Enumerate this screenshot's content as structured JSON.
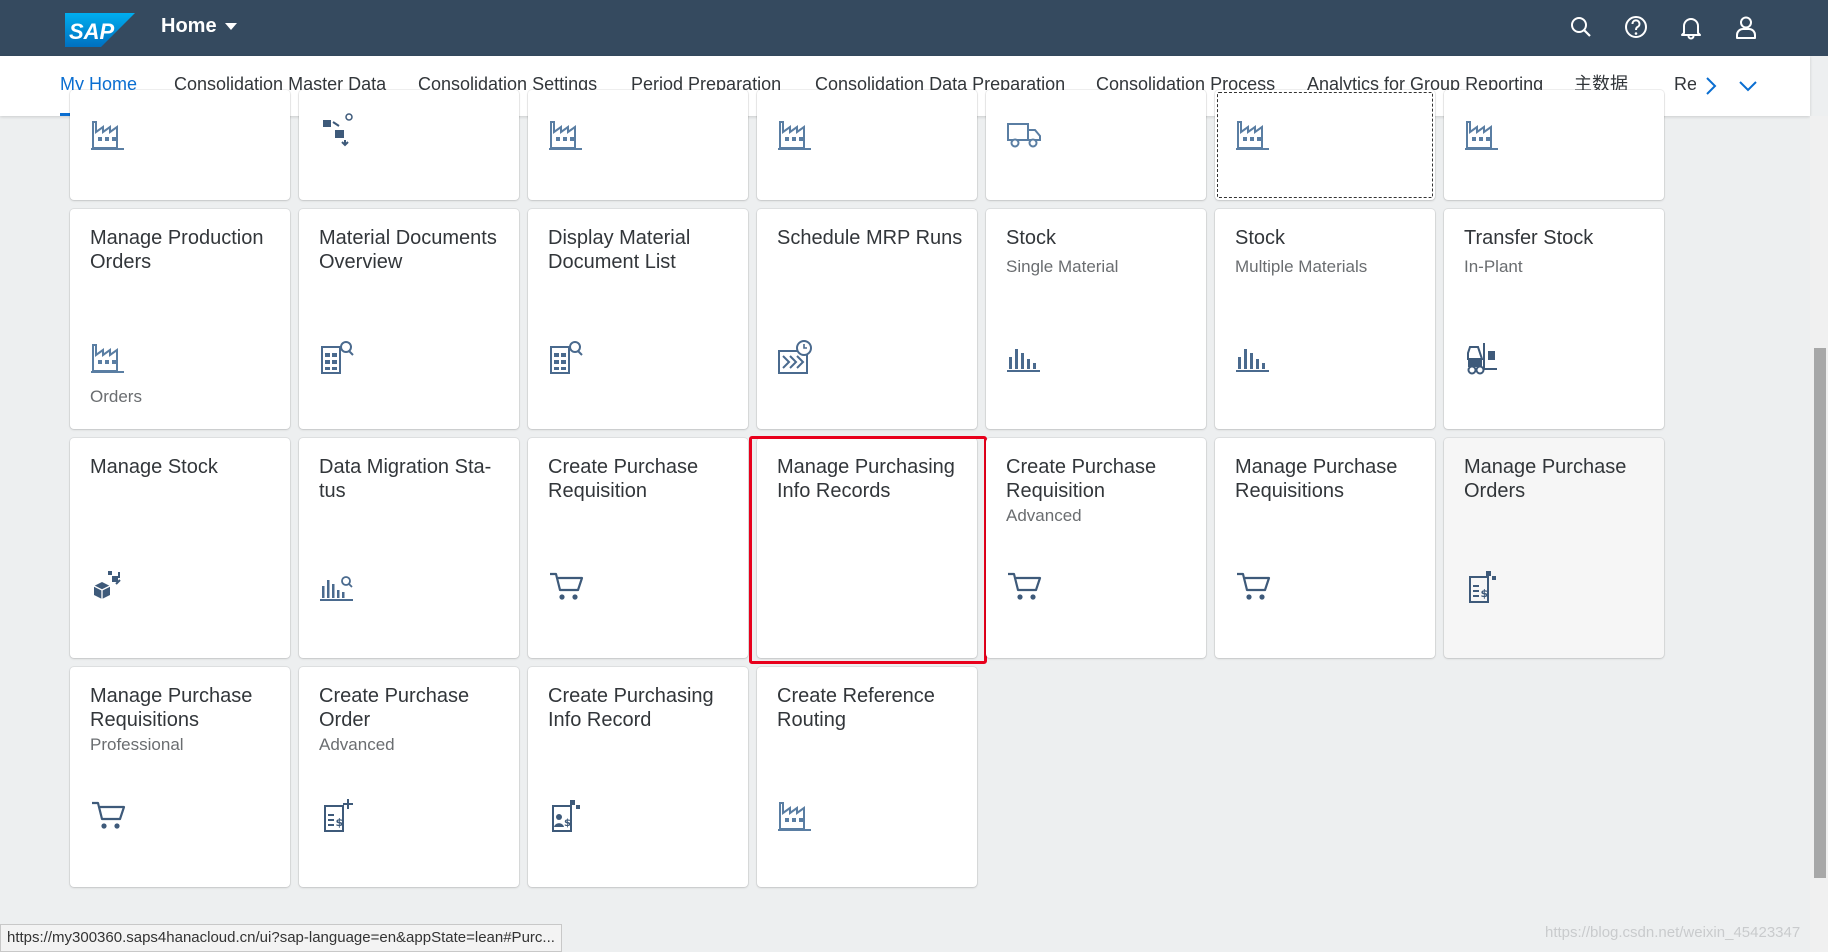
{
  "shell": {
    "logo_text": "SAP",
    "title": "Home",
    "icons": [
      "search-icon",
      "help-icon",
      "notification-bell-icon",
      "user-profile-icon"
    ],
    "brand_color": "#354a5f"
  },
  "tabs": [
    {
      "label": "My Home",
      "active": true
    },
    {
      "label": "Consolidation Master Data"
    },
    {
      "label": "Consolidation Settings"
    },
    {
      "label": "Period Preparation"
    },
    {
      "label": "Consolidation Data Preparation"
    },
    {
      "label": "Consolidation Process"
    },
    {
      "label": "Analytics for Group Reporting"
    },
    {
      "label": "主数据"
    }
  ],
  "tab_overflow_label": "Re",
  "tiles_row0_icons": [
    "factory-icon",
    "material-movement-icon",
    "factory-icon",
    "factory-icon",
    "truck-icon",
    "factory-icon",
    "factory-icon"
  ],
  "tiles_row1": [
    {
      "title": "Manage Production Orders",
      "subtitle": "",
      "footer": "Orders",
      "icon": "factory-icon"
    },
    {
      "title": "Material Documents Overview",
      "subtitle": "",
      "footer": "",
      "icon": "document-search-icon"
    },
    {
      "title": "Display Material Document List",
      "subtitle": "",
      "footer": "",
      "icon": "document-search-icon"
    },
    {
      "title": "Schedule MRP Runs",
      "subtitle": "",
      "footer": "",
      "icon": "scheduled-run-icon"
    },
    {
      "title": "Stock",
      "subtitle": "Single Material",
      "footer": "",
      "icon": "bar-chart-icon"
    },
    {
      "title": "Stock",
      "subtitle": "Multiple Materials",
      "footer": "",
      "icon": "bar-chart-icon"
    },
    {
      "title": "Transfer Stock",
      "subtitle": "In-Plant",
      "footer": "",
      "icon": "forklift-icon"
    }
  ],
  "tiles_row2": [
    {
      "title": "Manage Stock",
      "subtitle": "",
      "icon": "cubes-icon"
    },
    {
      "title": "Data Migration Sta-tus",
      "subtitle": "",
      "icon": "chart-search-icon"
    },
    {
      "title": "Create Purchase Requisition",
      "subtitle": "",
      "icon": "cart-icon"
    },
    {
      "title": "Manage Purchasing Info Records",
      "subtitle": "",
      "icon": ""
    },
    {
      "title": "Create Purchase Requisition",
      "subtitle": "Advanced",
      "icon": "cart-icon"
    },
    {
      "title": "Manage Purchase Requisitions",
      "subtitle": "",
      "icon": "cart-icon"
    },
    {
      "title": "Manage Purchase Orders",
      "subtitle": "",
      "icon": "purchase-order-icon"
    }
  ],
  "tiles_row3": [
    {
      "title": "Manage Purchase Requisitions",
      "subtitle": "Professional",
      "icon": "cart-icon"
    },
    {
      "title": "Create Purchase Order",
      "subtitle": "Advanced",
      "icon": "purchase-order-add-icon"
    },
    {
      "title": "Create Purchasing Info Record",
      "subtitle": "",
      "icon": "info-record-icon"
    },
    {
      "title": "Create Reference Routing",
      "subtitle": "",
      "icon": "factory-icon"
    }
  ],
  "status_url": "https://my300360.saps4hanacloud.cn/ui?sap-language=en&appState=lean#Purc...",
  "watermark": "https://blog.csdn.net/weixin_45423347",
  "highlight_color": "#e8001c",
  "accent_color": "#0a6ed1"
}
